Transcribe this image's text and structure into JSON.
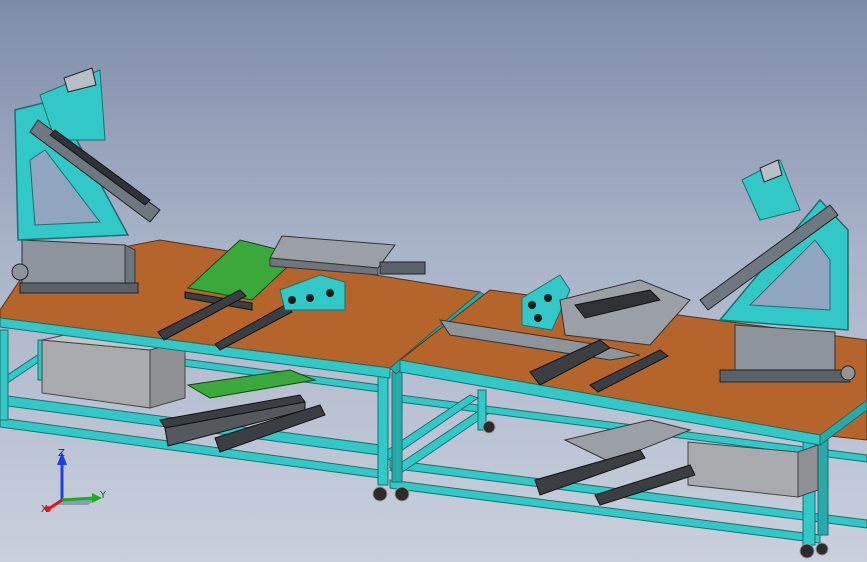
{
  "triad": {
    "x_label": "X",
    "y_label": "Y",
    "z_label": "Z"
  },
  "colors": {
    "background_top": "#7f8ca9",
    "background_bottom": "#c9cfdc",
    "frame": "#32c8c8",
    "table_top": "#b5652c",
    "pcb": "#3aa83a",
    "rail": "#3b3f44",
    "cabinet": "#a9aaad",
    "steel": "#8d949c",
    "axis_x": "#e01818",
    "axis_y": "#18b018",
    "axis_z": "#2040e0"
  }
}
